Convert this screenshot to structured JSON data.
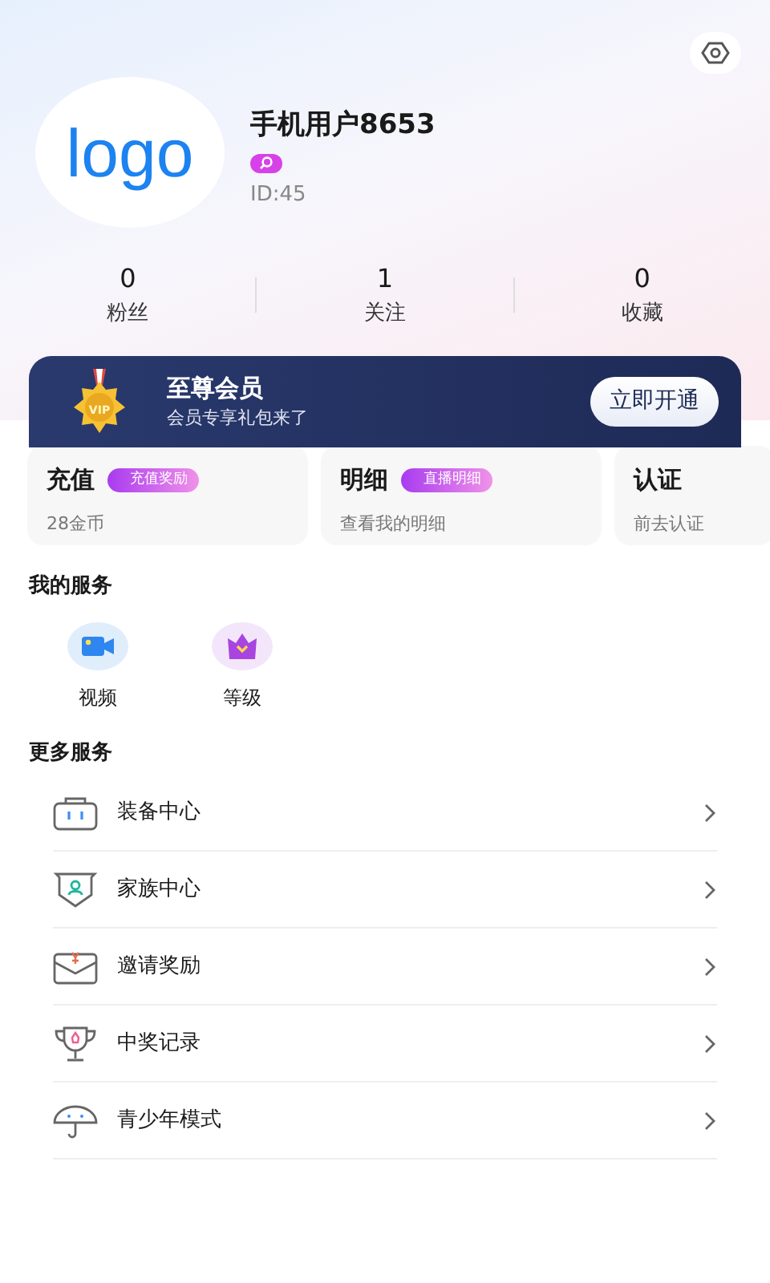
{
  "profile": {
    "avatar_text": "logo",
    "name": "手机用户8653",
    "id": "ID:45"
  },
  "stats": [
    {
      "value": "0",
      "label": "粉丝"
    },
    {
      "value": "1",
      "label": "关注"
    },
    {
      "value": "0",
      "label": "收藏"
    }
  ],
  "vip": {
    "badge": "VIP",
    "title": "至尊会员",
    "subtitle": "会员专享礼包来了",
    "button": "立即开通"
  },
  "cards": [
    {
      "title": "充值",
      "tag": "充值奖励",
      "subtitle": "28金币"
    },
    {
      "title": "明细",
      "tag": "直播明细",
      "subtitle": "查看我的明细"
    },
    {
      "title": "认证",
      "subtitle": "前去认证"
    }
  ],
  "my_services": {
    "title": "我的服务",
    "items": [
      {
        "kind": "video",
        "label": "视频"
      },
      {
        "kind": "level",
        "label": "等级"
      }
    ]
  },
  "more_services": {
    "title": "更多服务",
    "items": [
      {
        "kind": "equipment",
        "label": "装备中心"
      },
      {
        "kind": "family",
        "label": "家族中心"
      },
      {
        "kind": "invite",
        "label": "邀请奖励"
      },
      {
        "kind": "prize",
        "label": "中奖记录"
      },
      {
        "kind": "teen",
        "label": "青少年模式"
      }
    ]
  }
}
